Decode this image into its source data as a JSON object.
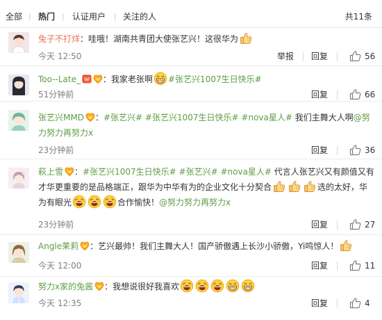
{
  "filters": {
    "all": "全部",
    "hot": "热门",
    "verified": "认证用户",
    "following": "关注的人",
    "total": "共11条"
  },
  "icons": {
    "like": "thumbs-up-icon",
    "emoji_thumb": "thumbs-up-emoji-icon",
    "emoji_grin": "grinning-emoji-icon",
    "emoji_laugh": "laughing-emoji-icon",
    "badge_yellow": "yellow-fan-badge-icon",
    "badge_red": "red-vip-badge-icon"
  },
  "actions": {
    "report": "举报",
    "reply": "回复"
  },
  "comments": [
    {
      "username": "兔子不打烊",
      "p1": "：哇哦！湖南共青团大使张艺兴！这很华为",
      "time": "今天 12:50",
      "likes": "56"
    },
    {
      "username": "Too--Late_",
      "p1": "：我家老张啊",
      "t1": "#张艺兴1007生日快乐#",
      "time": "51分钟前",
      "likes": "66"
    },
    {
      "username": "张艺兴MMD",
      "p1": "：",
      "t1": "#张艺兴#",
      "t2": "#张艺兴1007生日快乐#",
      "t3": "#nova星人#",
      "p2": " 我们主舞大人啊",
      "mention": "@努力努力再努力x",
      "time": "23分钟前",
      "likes": "36"
    },
    {
      "username": "萩上雪",
      "p1": "：",
      "t1": "#张艺兴1007生日快乐#",
      "t2": "#张艺兴#",
      "t3": "#nova星人#",
      "p2": " 代言人张艺兴又有颜值",
      "line2": "又有才华更重要的是品格端正，跟华为中华有为的企业文化十分契合",
      "p3": "选的",
      "line3": "太好，华为有眼光",
      "p4": "合作愉快！",
      "mention": "@努力努力再努力x",
      "time": "23分钟前",
      "likes": "27"
    },
    {
      "username": "Angle茉莉",
      "p1": "：艺兴最帅！我们主舞大人！国产骄傲遇上长沙小骄傲，Yi鸣惊人！",
      "time": "今天 12:00",
      "likes": "11"
    },
    {
      "username": "努力x家的兔酱",
      "p1": "：我想说很好我喜欢",
      "time": "今天 12:35",
      "likes": "4"
    }
  ]
}
